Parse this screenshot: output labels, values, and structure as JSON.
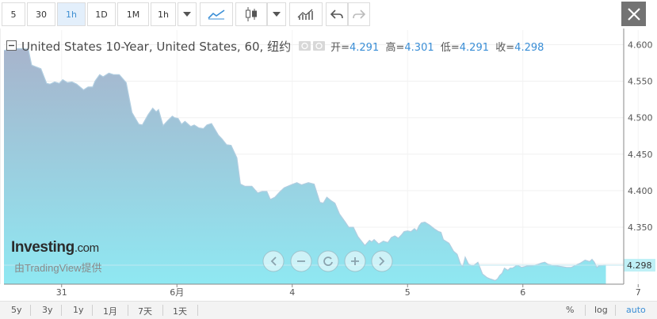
{
  "toolbar": {
    "intervals": [
      "5",
      "30",
      "1h",
      "1D",
      "1M",
      "1h"
    ],
    "active_interval": "1h",
    "icons": [
      "line-chart-icon",
      "candlestick-icon",
      "indicators-icon",
      "undo-icon",
      "redo-icon",
      "close-icon"
    ]
  },
  "legend": {
    "title": "United States 10-Year, United States, 60, 纽约",
    "open_label": "开=",
    "open": "4.291",
    "high_label": "高=",
    "high": "4.301",
    "low_label": "低=",
    "low": "4.291",
    "close_label": "收=",
    "close": "4.298"
  },
  "branding": {
    "brand": "Investing",
    "brand_suffix": ".com",
    "powered": "由TradingView提供"
  },
  "nav_buttons": [
    "scroll-left-icon",
    "zoom-out-icon",
    "reset-icon",
    "zoom-in-icon",
    "scroll-right-icon"
  ],
  "bottombar": {
    "ranges": [
      "5y",
      "3y",
      "1y",
      "1月",
      "7天",
      "1天"
    ],
    "percent": "%",
    "log": "log",
    "auto": "auto"
  },
  "colors": {
    "accent": "#3a8ed6",
    "area_top": "#a7b4cc",
    "area_bottom": "#8fe8f2",
    "line": "#b0cde0"
  },
  "chart_data": {
    "type": "area",
    "title": "United States 10-Year, United States, 60, 纽约",
    "xlabel": "",
    "ylabel": "",
    "ylim": [
      4.272,
      4.62
    ],
    "yticks": [
      4.6,
      4.55,
      4.5,
      4.45,
      4.4,
      4.35,
      4.3
    ],
    "ytick_labels": [
      "4.600",
      "4.550",
      "4.500",
      "4.450",
      "4.400",
      "4.350",
      "4.300"
    ],
    "xticks": [
      {
        "label": "31",
        "x": 0.5
      },
      {
        "label": "6月",
        "x": 1.5
      },
      {
        "label": "4",
        "x": 2.5
      },
      {
        "label": "5",
        "x": 3.5
      },
      {
        "label": "6",
        "x": 4.5
      },
      {
        "label": "7",
        "x": 5.5
      }
    ],
    "last_value": "4.298",
    "x": [
      0,
      0.08,
      0.21,
      0.24,
      0.32,
      0.37,
      0.4,
      0.44,
      0.48,
      0.51,
      0.55,
      0.59,
      0.63,
      0.69,
      0.73,
      0.77,
      0.79,
      0.83,
      0.86,
      0.91,
      0.95,
      1,
      1.06,
      1.11,
      1.17,
      1.2,
      1.25,
      1.29,
      1.32,
      1.34,
      1.38,
      1.42,
      1.46,
      1.48,
      1.51,
      1.54,
      1.57,
      1.62,
      1.65,
      1.69,
      1.73,
      1.76,
      1.8,
      1.86,
      1.89,
      1.93,
      1.97,
      2.02,
      2.05,
      2.09,
      2.15,
      2.2,
      2.24,
      2.28,
      2.31,
      2.35,
      2.39,
      2.43,
      2.49,
      2.54,
      2.58,
      2.64,
      2.69,
      2.74,
      2.77,
      2.8,
      2.84,
      2.87,
      2.91,
      2.96,
      2.99,
      3.03,
      3.07,
      3.1,
      3.13,
      3.17,
      3.19,
      3.21,
      3.25,
      3.29,
      3.33,
      3.36,
      3.39,
      3.42,
      3.45,
      3.47,
      3.5,
      3.53,
      3.56,
      3.58,
      3.6,
      3.62,
      3.65,
      3.69,
      3.73,
      3.77,
      3.79,
      3.81,
      3.86,
      3.9,
      3.93,
      3.96,
      3.98,
      4,
      4.03,
      4.07,
      4.11,
      4.15,
      4.19,
      4.22,
      4.26,
      4.28,
      4.3,
      4.32,
      4.34,
      4.37,
      4.39,
      4.41,
      4.45,
      4.49,
      4.54,
      4.58,
      4.63,
      4.66,
      4.69,
      4.72,
      4.75,
      4.79,
      4.84,
      4.88,
      4.92,
      4.96,
      5,
      5.04,
      5.08,
      5.1,
      5.12,
      5.14,
      5.16,
      5.2,
      5.22
    ],
    "series": [
      {
        "values": [
          4.592,
          4.595,
          4.594,
          4.572,
          4.567,
          4.547,
          4.546,
          4.549,
          4.547,
          4.552,
          4.548,
          4.549,
          4.546,
          4.538,
          4.542,
          4.542,
          4.55,
          4.559,
          4.556,
          4.561,
          4.559,
          4.559,
          4.548,
          4.507,
          4.491,
          4.49,
          4.504,
          4.513,
          4.508,
          4.511,
          4.489,
          4.496,
          4.502,
          4.5,
          4.499,
          4.491,
          4.495,
          4.488,
          4.49,
          4.486,
          4.485,
          4.49,
          4.492,
          4.476,
          4.471,
          4.463,
          4.462,
          4.445,
          4.409,
          4.406,
          4.406,
          4.397,
          4.399,
          4.399,
          4.388,
          4.391,
          4.398,
          4.404,
          4.408,
          4.411,
          4.408,
          4.411,
          4.409,
          4.384,
          4.383,
          4.391,
          4.386,
          4.383,
          4.368,
          4.357,
          4.35,
          4.35,
          4.337,
          4.331,
          4.325,
          4.332,
          4.33,
          4.333,
          4.327,
          4.331,
          4.329,
          4.336,
          4.338,
          4.335,
          4.34,
          4.344,
          4.345,
          4.344,
          4.348,
          4.345,
          4.352,
          4.356,
          4.357,
          4.353,
          4.348,
          4.344,
          4.343,
          4.333,
          4.328,
          4.317,
          4.313,
          4.299,
          4.296,
          4.309,
          4.299,
          4.297,
          4.302,
          4.286,
          4.281,
          4.279,
          4.277,
          4.279,
          4.284,
          4.287,
          4.294,
          4.291,
          4.294,
          4.294,
          4.298,
          4.295,
          4.297,
          4.297,
          4.299,
          4.301,
          4.302,
          4.299,
          4.298,
          4.297,
          4.296,
          4.295,
          4.295,
          4.298,
          4.301,
          4.305,
          4.303,
          4.306,
          4.302,
          4.295,
          4.297,
          4.298,
          4.298
        ]
      }
    ]
  }
}
